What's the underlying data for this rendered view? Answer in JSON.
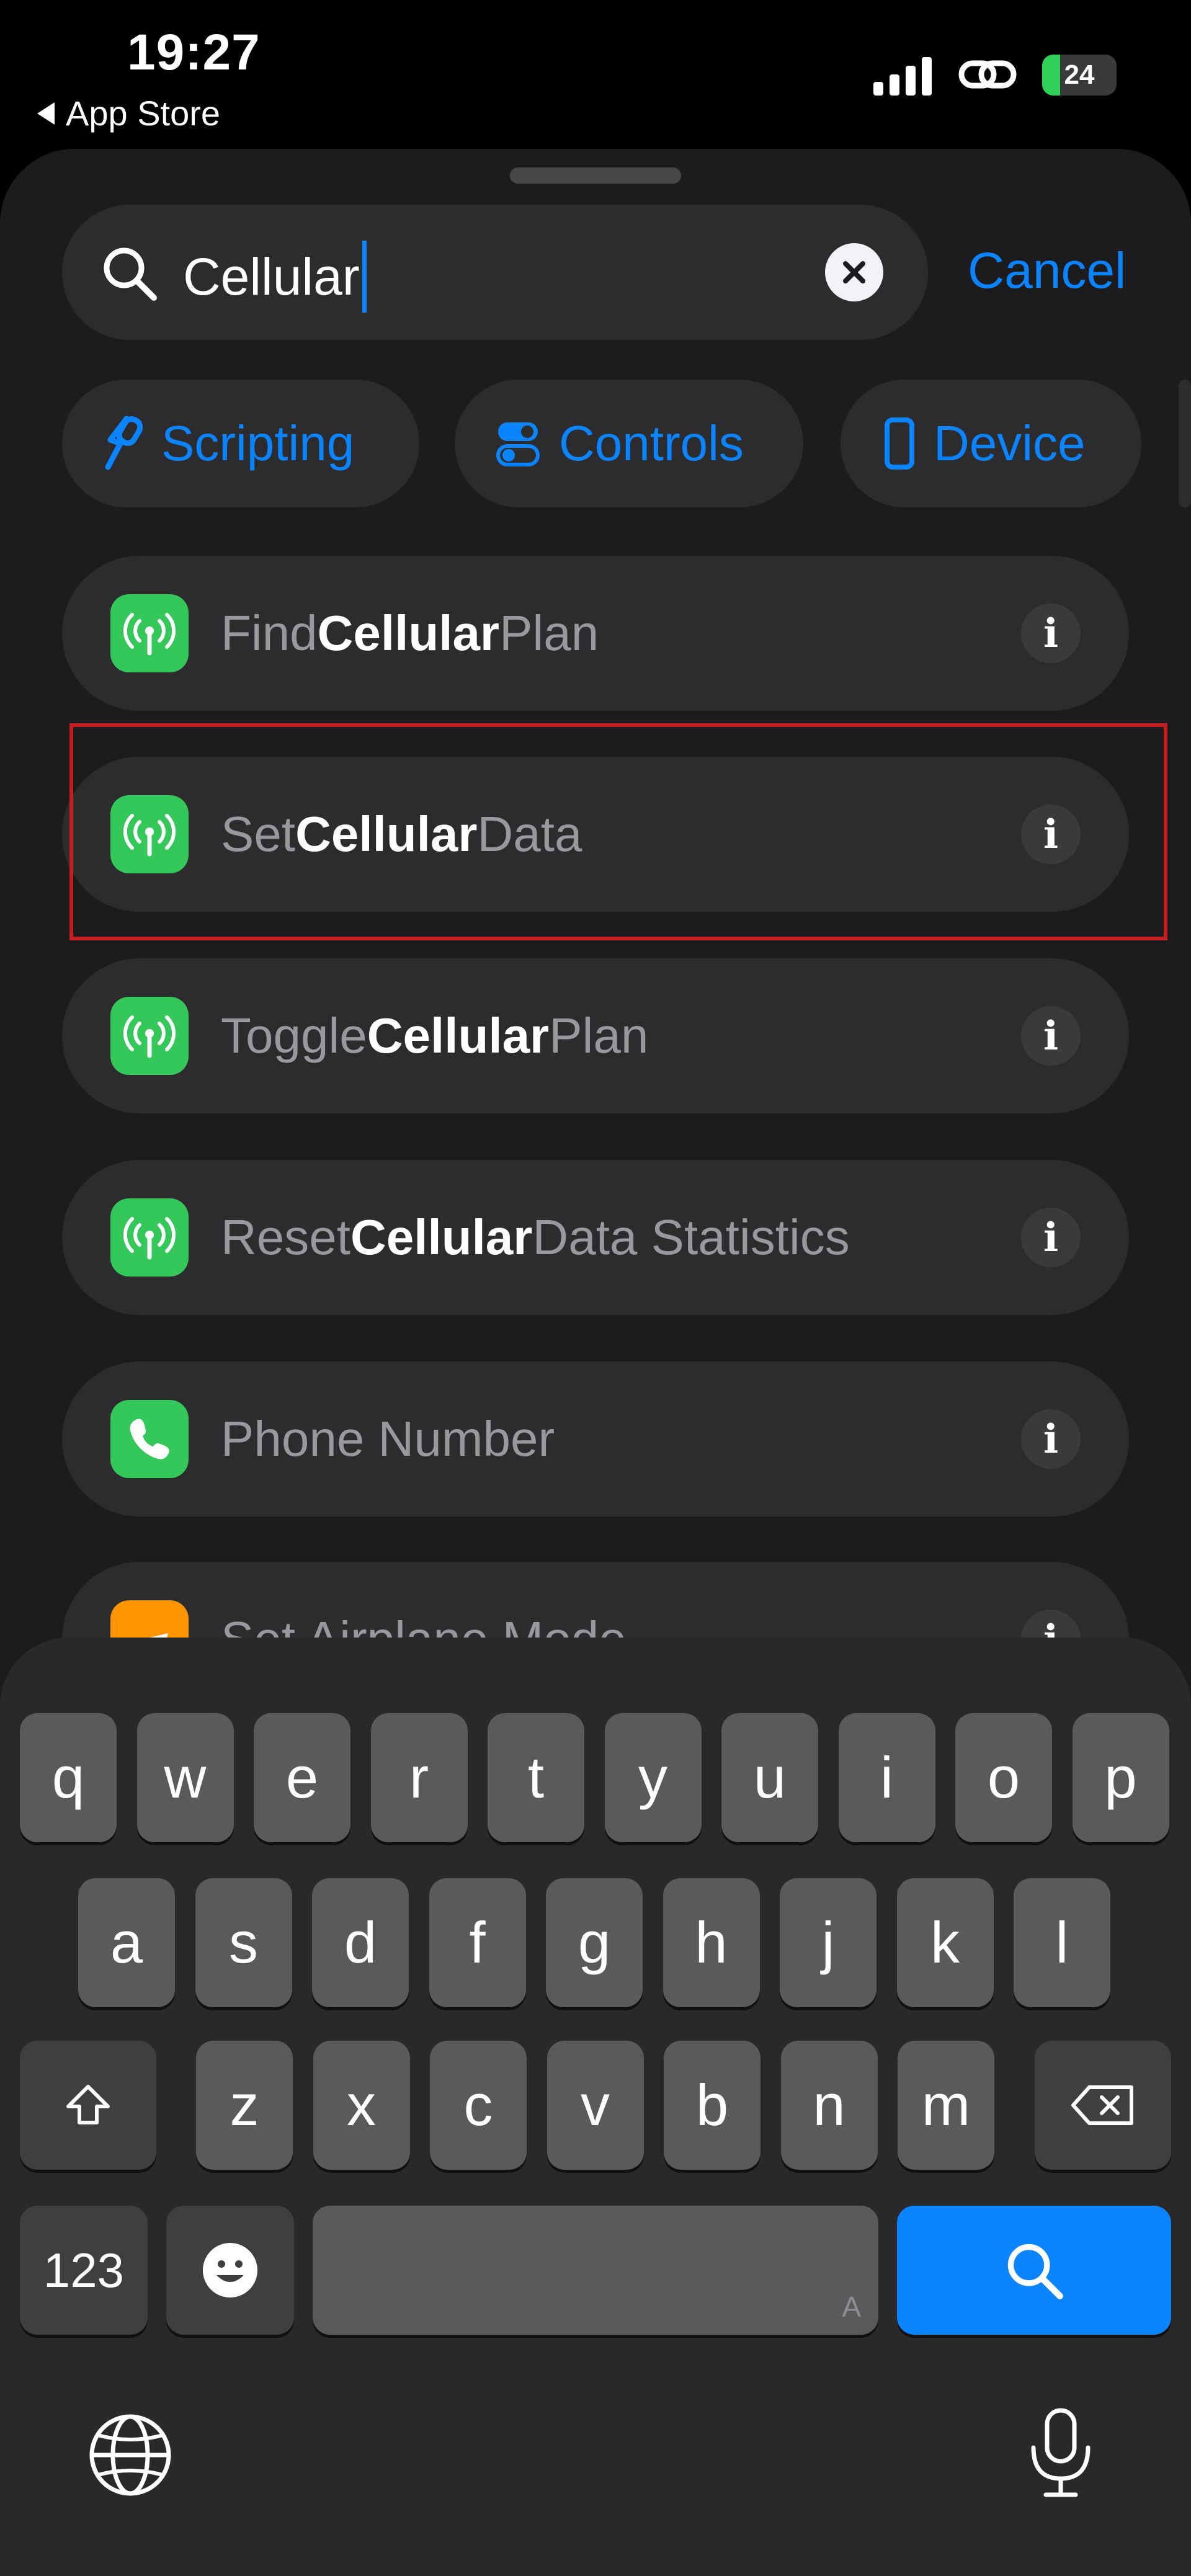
{
  "status_bar": {
    "time": "19:27",
    "back_app": "App Store",
    "battery": "24",
    "icons": [
      "signal-icon",
      "link-icon",
      "battery-icon"
    ]
  },
  "search": {
    "value": "Cellular",
    "cancel_label": "Cancel"
  },
  "chips": [
    {
      "label": "Scripting",
      "icon": "scripting-icon"
    },
    {
      "label": "Controls",
      "icon": "controls-icon"
    },
    {
      "label": "Device",
      "icon": "device-icon"
    }
  ],
  "results": [
    {
      "pre": "Find ",
      "match": "Cellular",
      "post": " Plan",
      "icon": "antenna-icon"
    },
    {
      "pre": "Set ",
      "match": "Cellular",
      "post": " Data",
      "icon": "antenna-icon"
    },
    {
      "pre": "Toggle ",
      "match": "Cellular",
      "post": " Plan",
      "icon": "antenna-icon"
    },
    {
      "pre": "Reset ",
      "match": "Cellular",
      "post": " Data Statistics",
      "icon": "antenna-icon"
    },
    {
      "pre": "Phone Number",
      "match": "",
      "post": "",
      "icon": "phone-icon"
    },
    {
      "pre": "Set Airplane Mode",
      "match": "",
      "post": "",
      "icon": "airplane-icon"
    }
  ],
  "keyboard": {
    "row1": [
      "q",
      "w",
      "e",
      "r",
      "t",
      "y",
      "u",
      "i",
      "o",
      "p"
    ],
    "row2": [
      "a",
      "s",
      "d",
      "f",
      "g",
      "h",
      "j",
      "k",
      "l"
    ],
    "row3": [
      "z",
      "x",
      "c",
      "v",
      "b",
      "n",
      "m"
    ],
    "numbers_label": "123",
    "space_hint": "A"
  },
  "colors": {
    "accent": "#0a84ff",
    "green_icon": "#34c759",
    "highlight": "#c41e1e"
  }
}
